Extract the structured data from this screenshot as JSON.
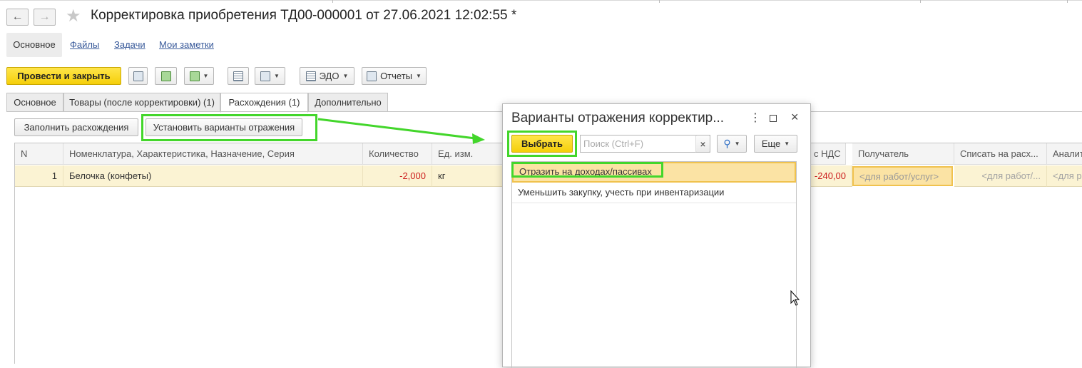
{
  "window": {
    "title": "Корректировка приобретения ТД00-000001 от 27.06.2021 12:02:55 *"
  },
  "nav": {
    "back_icon": "arrow-left-icon",
    "forward_icon": "arrow-right-icon",
    "favorite_icon": "star-icon"
  },
  "sections": [
    {
      "label": "Основное",
      "active": true
    },
    {
      "label": "Файлы",
      "active": false
    },
    {
      "label": "Задачи",
      "active": false
    },
    {
      "label": "Мои заметки",
      "active": false
    }
  ],
  "toolbar": {
    "post_close_label": "Провести и закрыть",
    "edo_label": "ЭДО",
    "reports_label": "Отчеты"
  },
  "tabs": [
    {
      "label": "Основное"
    },
    {
      "label": "Товары (после корректировки) (1)"
    },
    {
      "label": "Расхождения (1)"
    },
    {
      "label": "Дополнительно"
    }
  ],
  "discrepancies": {
    "fill_button": "Заполнить расхождения",
    "set_variants_button": "Установить варианты отражения",
    "columns": [
      "N",
      "Номенклатура, Характеристика, Назначение, Серия",
      "Количество",
      "Ед. изм.",
      "с НДС",
      "Получатель",
      "Списать на расх...",
      "Аналит"
    ],
    "rows": [
      {
        "n": "1",
        "item": "Белочка (конфеты)",
        "quantity": "-2,000",
        "unit": "кг",
        "sum_vat": "-240,00",
        "recipient": "<для работ/услуг>",
        "write_off": "<для работ/...",
        "analytics": "<для ра"
      }
    ]
  },
  "dialog": {
    "title": "Варианты отражения корректир...",
    "select_button": "Выбрать",
    "search_placeholder": "Поиск (Ctrl+F)",
    "search_clear": "×",
    "more_label": "Еще",
    "options": [
      {
        "label": "Отразить на доходах/пассивах",
        "selected": true
      },
      {
        "label": "Уменьшить закупку, учесть при инвентаризации",
        "selected": false
      }
    ]
  },
  "colors": {
    "accent_yellow": "#f5cf0a",
    "highlight_green": "#43d62b",
    "negative_red": "#cc1e1e",
    "link_blue": "#3a5b9b",
    "selection": "#fbe3a4"
  }
}
